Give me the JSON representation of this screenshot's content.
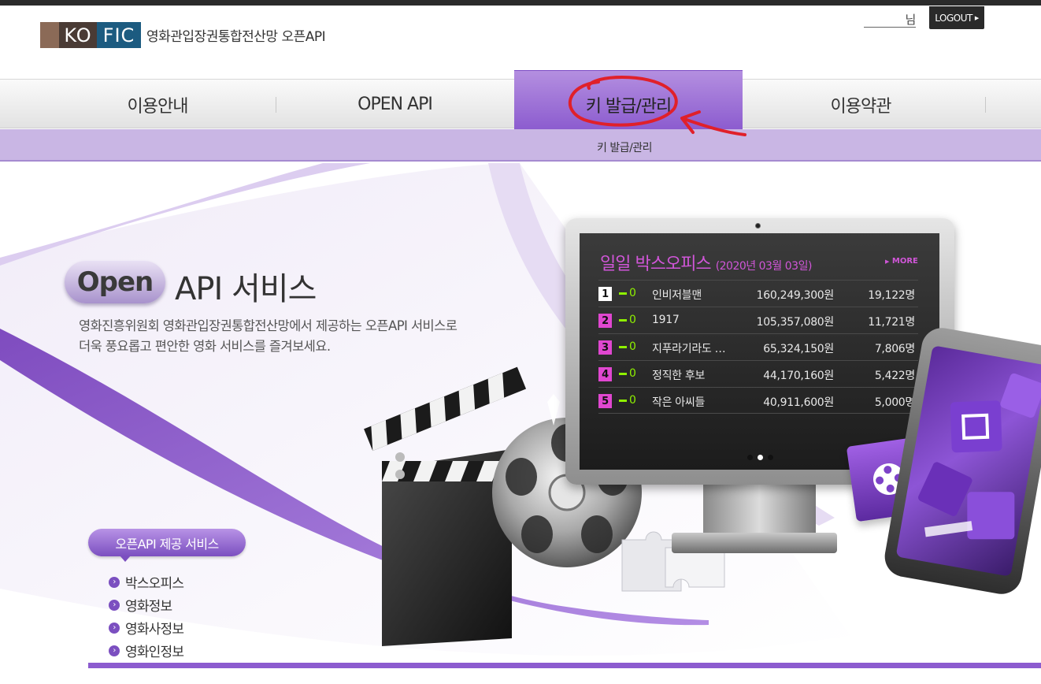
{
  "header": {
    "logo_mark": "KOFIC",
    "logo_text": "영화관입장권통합전산망 오픈API",
    "user_name": "님",
    "logout_label": "LOGOUT"
  },
  "nav": {
    "items": [
      {
        "label": "이용안내"
      },
      {
        "label": "OPEN API"
      },
      {
        "label": "키 발급/관리"
      },
      {
        "label": "이용약관"
      }
    ],
    "sub_label": "키 발급/관리"
  },
  "hero": {
    "open_label": "Open",
    "title": "API 서비스",
    "desc_line1": "영화진흥위원회 영화관입장권통합전산망에서 제공하는 오픈API 서비스로",
    "desc_line2": "더욱 풍요롭고 편안한 영화 서비스를 즐겨보세요."
  },
  "services": {
    "title": "오픈API 제공 서비스",
    "items": [
      {
        "label": "박스오피스"
      },
      {
        "label": "영화정보"
      },
      {
        "label": "영화사정보"
      },
      {
        "label": "영화인정보"
      }
    ]
  },
  "boxoffice": {
    "title": "일일 박스오피스",
    "date": "(2020년 03월 03일)",
    "more_label": "MORE",
    "rows": [
      {
        "rank": "1",
        "change": "0",
        "movie": "인비저블맨",
        "sales": "160,249,300원",
        "audience": "19,122명"
      },
      {
        "rank": "2",
        "change": "0",
        "movie": "1917",
        "sales": "105,357,080원",
        "audience": "11,721명"
      },
      {
        "rank": "3",
        "change": "0",
        "movie": "지푸라기라도 …",
        "sales": "65,324,150원",
        "audience": "7,806명"
      },
      {
        "rank": "4",
        "change": "0",
        "movie": "정직한 후보",
        "sales": "44,170,160원",
        "audience": "5,422명"
      },
      {
        "rank": "5",
        "change": "0",
        "movie": "작은 아씨들",
        "sales": "40,911,600원",
        "audience": "5,000명"
      }
    ]
  },
  "colors": {
    "accent": "#8c5ccf",
    "annotation": "#e0202a",
    "boxoffice_title": "#d056d8"
  }
}
